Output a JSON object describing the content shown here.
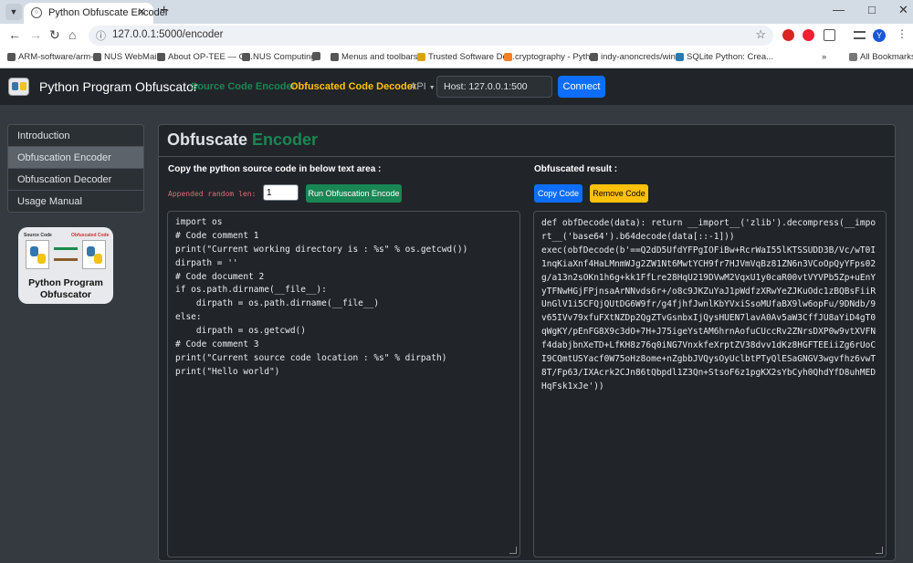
{
  "browser": {
    "tab_title": "Python Obfuscate Encoder",
    "url": "127.0.0.1:5000/encoder",
    "profile_initial": "Y",
    "bookmarks": [
      "ARM-software/arm-...",
      "NUS WebMail",
      "About OP-TEE — O...",
      "NUS Computing",
      "Menus and toolbars...",
      "Trusted Software De...",
      "cryptography - Pyth...",
      "indy-anoncreds/win...",
      "SQLite Python: Crea..."
    ],
    "all_bookmarks": "All Bookmarks"
  },
  "navbar": {
    "brand": "Python Program Obfuscator",
    "links": [
      "Source Code Encoder",
      "Obfuscated Code Decoder",
      "API"
    ],
    "link_colors": [
      "#198754",
      "#ffc107",
      "#adb5bd"
    ],
    "host_value": "Host: 127.0.0.1:500",
    "connect_label": "Connect"
  },
  "sidebar": {
    "items": [
      "Introduction",
      "Obfuscation Encoder",
      "Obfuscation Decoder",
      "Usage Manual"
    ],
    "active_index": 1
  },
  "promo": {
    "source_label": "Source Code",
    "obf_label": "Obfuscated Code",
    "title_line1": "Python Program",
    "title_line2": "Obfuscator"
  },
  "main": {
    "title_prefix": "Obfuscate",
    "title_accent": "Encoder",
    "left_heading": "Copy the python source code in below text area :",
    "right_heading": "Obfuscated result :",
    "random_len_label": "Appended random len:",
    "random_len_value": "1",
    "run_button": "Run Obfuscation Encode",
    "copy_button": "Copy Code",
    "remove_button": "Remove Code",
    "source_lines": [
      "import os",
      "# Code comment 1",
      "print(\"Current working directory is : %s\" % os.getcwd())",
      "dirpath = ''",
      "# Code document 2",
      "if os.path.dirname(__file__):",
      "    dirpath = os.path.dirname(__file__)",
      "else:",
      "    dirpath = os.getcwd()",
      "# Code comment 3",
      "print(\"Current source code location : %s\" % dirpath)",
      "print(\"Hello world\")"
    ],
    "output_text": "def obfDecode(data): return __import__('zlib').decompress(__import__('base64').b64decode(data[::-1]))\nexec(obfDecode(b'==Q2dD5UfdYFPgIOFiBw+RcrWaI55lKTSSUDD3B/Vc/wT0I1nqKiaXnf4HaLMnmWJg2ZW1Nt6MwtYCH9fr7HJVmVqBz81ZN6n3VCoOpQyYFps02g/a13n2sOKn1h6g+kk1FfLre28HqU219DVwM2VqxU1y0caR00vtVYVPb5Zp+uEnYyTFNwHGjFPjnsaArNNvds6r+/o8c9JKZuYaJ1pWdfzXRwYeZJKuOdc1zBQBsFiiRUnGlV1i5CFQjQUtDG6W9fr/g4fjhfJwnlKbYVxiSsoMUfaBX9lw6opFu/9DNdb/9v65IVv79xfuFXtNZDp2QgZTvGsnbxIjQysHUEN7lavA0Av5aW3CffJU8aYiD4gT0qWgKY/pEnFG8X9c3dO+7H+J75igeYstAM6hrnAofuCUccRv2ZNrsDXP0w9vtXVFNf4dabjbnXeTD+LfKH8z76q0iNG7VnxkfeXrptZV38dvv1dKz8HGFTEEiiZg6rUoCI9CQmtUSYacf0W75oHz8ome+nZgbbJVQysOyUclbtPTyQlESaGNGV3wgvfhz6vwT8T/Fp63/IXAcrk2CJn86tQbpdl1Z3Qn+StsoF6z1pgKX2sYbCyh0QhdYfD8uhMEDHqFsk1xJe'))"
  }
}
